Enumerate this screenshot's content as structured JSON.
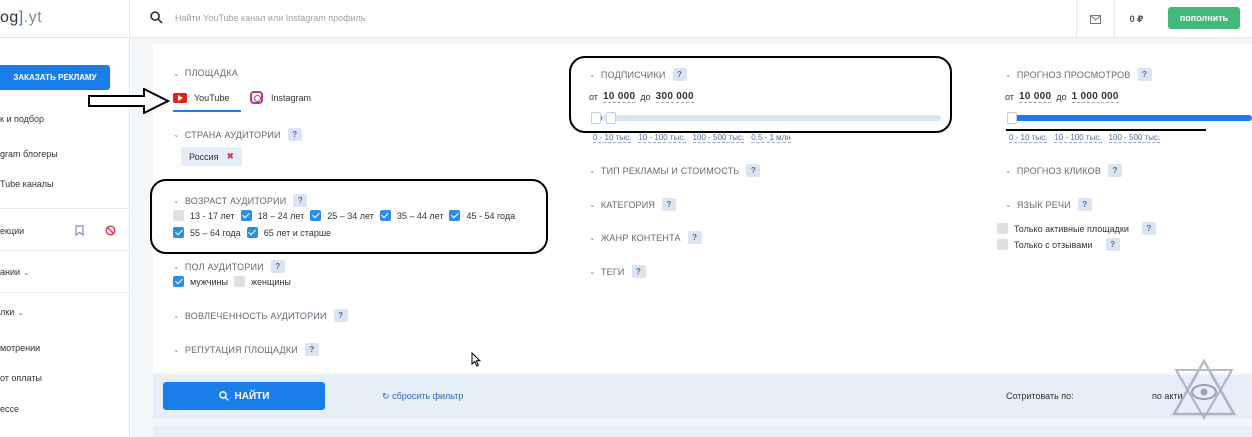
{
  "header": {
    "logo_main": "og",
    "logo_bracket": "]",
    "logo_suffix": ".yt",
    "search_placeholder": "Найти YouTube канал или Instagram профиль",
    "balance": "0 ₽",
    "topup_label": "пополнить"
  },
  "sidebar": {
    "order_button": "ЗАКАЗАТЬ РЕКЛАМУ",
    "items": [
      {
        "label": "к и подбор"
      },
      {
        "label": "gram блогеры"
      },
      {
        "label": "Tube каналы"
      },
      {
        "label": "екции"
      },
      {
        "label": "ании"
      },
      {
        "label": "лки"
      },
      {
        "label": "мотрении"
      },
      {
        "label": "от оплаты"
      },
      {
        "label": "есcе"
      }
    ]
  },
  "filters": {
    "platform": {
      "title": "ПЛОЩАДКА",
      "tabs": [
        {
          "label": "YouTube",
          "selected": true
        },
        {
          "label": "Instagram",
          "selected": false
        }
      ]
    },
    "audience_country": {
      "title": "СТРАНА АУДИТОРИИ",
      "tag": "Россия"
    },
    "audience_age": {
      "title": "ВОЗРАСТ АУДИТОРИИ",
      "options": [
        {
          "label": "13 - 17 лет",
          "checked": false
        },
        {
          "label": "18 – 24 лет",
          "checked": true
        },
        {
          "label": "25 – 34 лет",
          "checked": true
        },
        {
          "label": "35 – 44 лет",
          "checked": true
        },
        {
          "label": "45 - 54 года",
          "checked": true
        },
        {
          "label": "55 – 64 года",
          "checked": true
        },
        {
          "label": "65 лет и старше",
          "checked": true
        }
      ]
    },
    "audience_gender": {
      "title": "ПОЛ АУДИТОРИИ",
      "options": [
        {
          "label": "мужчины",
          "checked": true
        },
        {
          "label": "женщины",
          "checked": false
        }
      ]
    },
    "engagement": {
      "title": "ВОВЛЕЧЕННОСТЬ АУДИТОРИИ"
    },
    "reputation": {
      "title": "РЕПУТАЦИЯ ПЛОЩАДКИ"
    },
    "subscribers": {
      "title": "ПОДПИСЧИКИ",
      "from_label": "от",
      "from_value": "10 000",
      "to_label": "до",
      "to_value": "300 000",
      "range_fraction": [
        0.01,
        0.03
      ],
      "presets": [
        "0 - 10 тыс.",
        "10 - 100 тыс.",
        "100 - 500 тыс.",
        "0.5 - 1 млн"
      ]
    },
    "ad_type": {
      "title": "ТИП РЕКЛАМЫ И СТОИМОСТЬ"
    },
    "category": {
      "title": "КАТЕГОРИЯ"
    },
    "genre": {
      "title": "ЖАНР КОНТЕНТА"
    },
    "tags": {
      "title": "ТЕГИ"
    },
    "views_forecast": {
      "title": "ПРОГНОЗ ПРОСМОТРОВ",
      "from_label": "от",
      "from_value": "10 000",
      "to_label": "до",
      "to_value": "1 000 000",
      "range_fraction": [
        0.01,
        1.0
      ],
      "presets": [
        "0 - 10 тыс.",
        "10 - 100 тыс.",
        "100 - 500 тыс."
      ]
    },
    "clicks_forecast": {
      "title": "ПРОГНОЗ КЛИКОВ"
    },
    "speech_language": {
      "title": "ЯЗЫК РЕЧИ"
    },
    "extra_options": [
      {
        "label": "Только активные площадки",
        "checked": false
      },
      {
        "label": "Только с отзывами",
        "checked": false
      }
    ],
    "help": "?"
  },
  "toolbar": {
    "find_label": "НАЙТИ",
    "reset_label": "сбросить фильтр",
    "sort_label": "Сотритовать по:",
    "sort_value": "по акти"
  },
  "colors": {
    "primary": "#1a7ee8",
    "success": "#41b97a",
    "youtube": "#e62117",
    "instagram": "#c13584"
  }
}
